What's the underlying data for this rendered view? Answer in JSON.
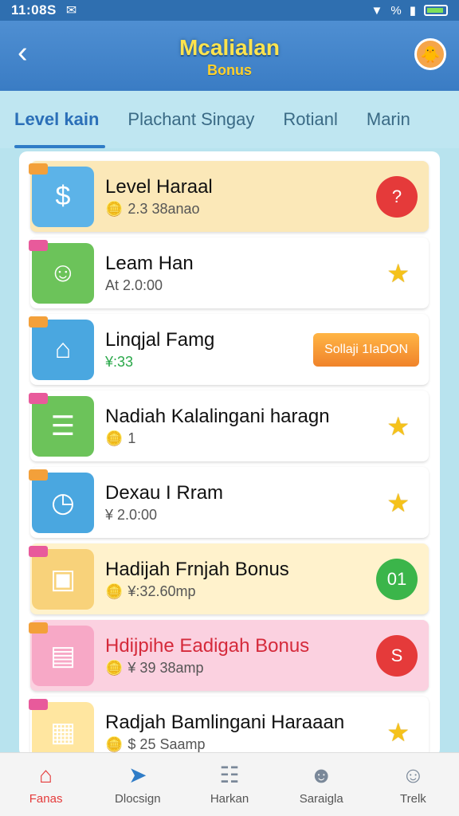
{
  "status": {
    "time": "11:08S",
    "signal": "%",
    "mail_icon": "mail-icon"
  },
  "header": {
    "back_icon": "‹",
    "title": "Mcalialan",
    "subtitle": "Bonus"
  },
  "tabs": [
    {
      "label": "Level kain",
      "active": true
    },
    {
      "label": "Plachant Singay",
      "active": false
    },
    {
      "label": "Rotianl",
      "active": false
    },
    {
      "label": "Marin",
      "active": false
    }
  ],
  "rows": [
    {
      "title": "Level Haraal",
      "sub": "2.3  38anao",
      "badge": "?",
      "style": "yellow",
      "thumb_icon": "$",
      "thumb_bg": "#5cb3e8"
    },
    {
      "title": "Leam Han",
      "sub": "At 2.0:00",
      "style": "plain",
      "thumb_icon": "☺",
      "thumb_bg": "#6cc35a"
    },
    {
      "title": "Linqjal Famg",
      "sub": "¥:33",
      "pill": "Sollaji 1IaDON",
      "style": "plain",
      "thumb_icon": "⌂",
      "thumb_bg": "#4aa7e0"
    },
    {
      "title": "Nadiah Kalalingani haragn",
      "sub": "1",
      "style": "plain",
      "thumb_icon": "☰",
      "thumb_bg": "#6cc35a"
    },
    {
      "title": "Dexau I Rram",
      "sub": "¥ 2.0:00",
      "style": "plain",
      "thumb_icon": "◷",
      "thumb_bg": "#4aa7e0"
    },
    {
      "title": "Hadijah Frnjah Bonus",
      "sub": "¥:32.60mp",
      "badge": "01",
      "style": "cream",
      "thumb_icon": "▣",
      "thumb_bg": "#f8d27a"
    },
    {
      "title": "Hdijpihe Eadigah Bonus",
      "sub": "¥ 39 38amp",
      "badge": "S",
      "style": "pink",
      "thumb_icon": "▤",
      "thumb_bg": "#f7a8c6"
    },
    {
      "title": "Radjah Bamlingani Haraaan",
      "sub": "$ 25 Saamp",
      "style": "plain",
      "thumb_icon": "▦",
      "thumb_bg": "#ffe6a0"
    }
  ],
  "nav": [
    {
      "label": "Fanas",
      "icon": "home-icon",
      "glyph": "⌂",
      "state": "active"
    },
    {
      "label": "Dlocsign",
      "icon": "rocket-icon",
      "glyph": "➤",
      "state": "blue"
    },
    {
      "label": "Harkan",
      "icon": "list-icon",
      "glyph": "☷",
      "state": "plain"
    },
    {
      "label": "Saraigla",
      "icon": "users-icon",
      "glyph": "☻",
      "state": "plain"
    },
    {
      "label": "Trelk",
      "icon": "profile-icon",
      "glyph": "☺",
      "state": "plain"
    }
  ],
  "colors": {
    "accent": "#2f7cc7",
    "header": "#3a7cc4",
    "title_yellow": "#ffe34d",
    "red": "#e53a3a",
    "green": "#3bb54a",
    "star": "#f5c21b"
  }
}
